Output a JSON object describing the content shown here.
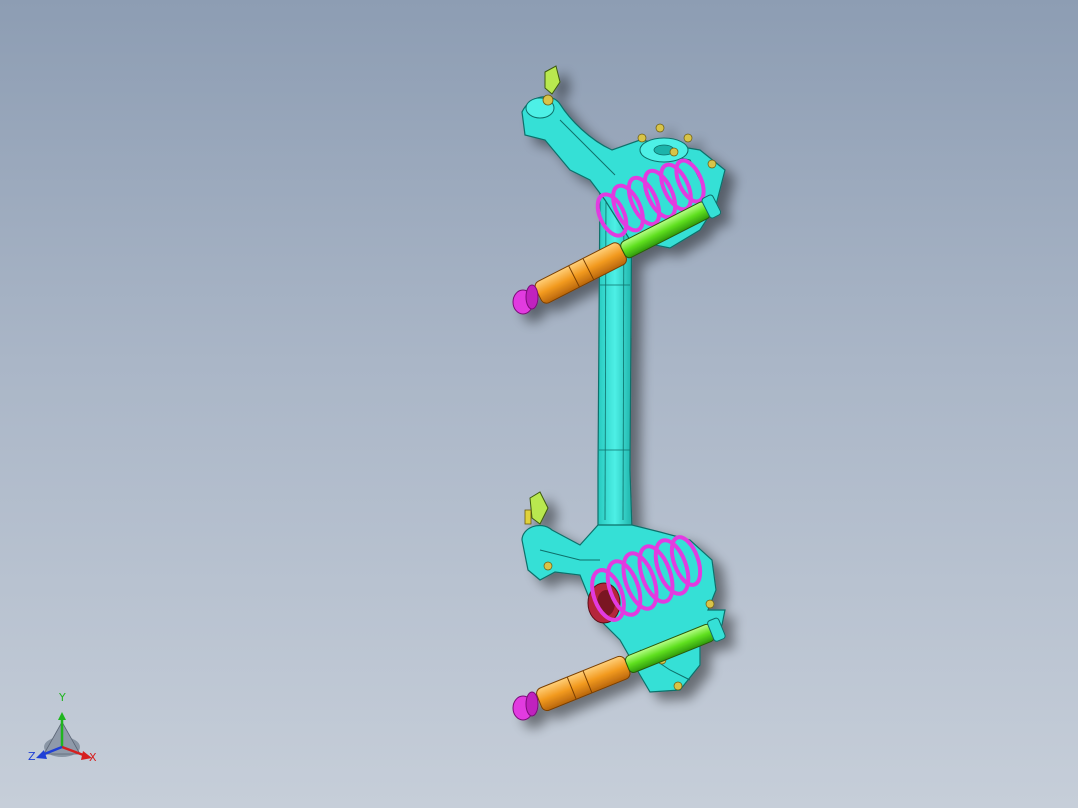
{
  "viewport": {
    "background_top": "#8d9db3",
    "background_bottom": "#c6ced9"
  },
  "model": {
    "name": "",
    "colors": {
      "frame": "#36e0d6",
      "frame_edge": "#0f6f6a",
      "coil_spring": "#e23be0",
      "shock_body": "#f29a1f",
      "shock_rod": "#5fe01f",
      "bump_stop": "#e23be0",
      "bushing": "#b5283a",
      "bolts": "#d8c44a"
    }
  },
  "triad": {
    "y_label": "Y",
    "z_label": "Z",
    "x_label": "X",
    "y_color": "#1fb51f",
    "z_color": "#1f3fd6",
    "x_color": "#d61f1f"
  }
}
